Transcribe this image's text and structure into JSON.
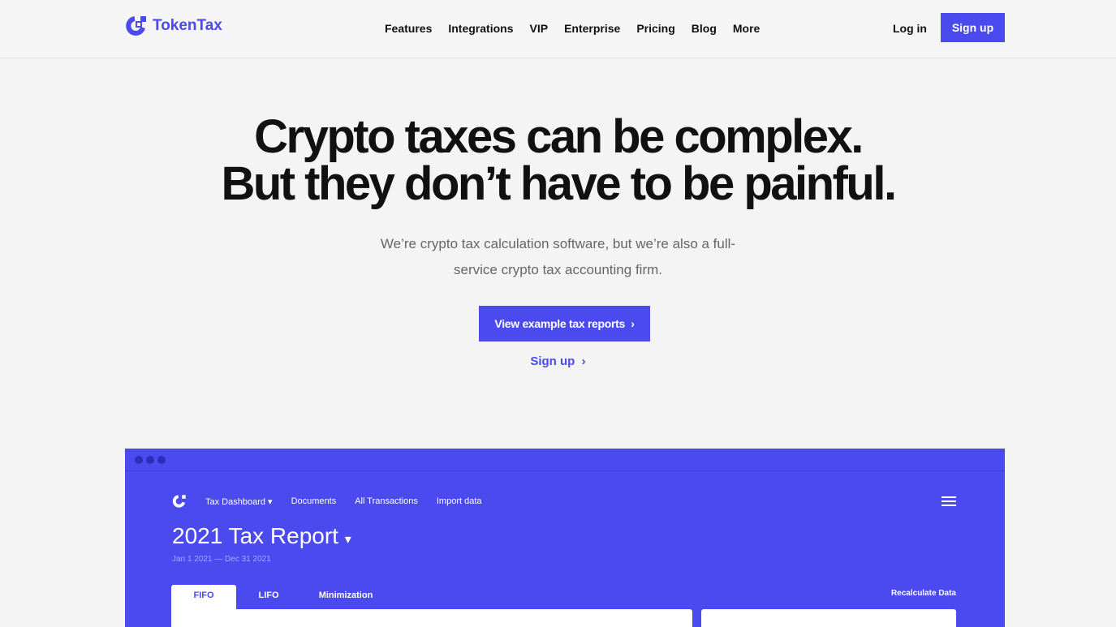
{
  "brand": {
    "name": "TokenTax",
    "color": "#4a4aee"
  },
  "nav": {
    "links": [
      "Features",
      "Integrations",
      "VIP",
      "Enterprise",
      "Pricing",
      "Blog",
      "More"
    ],
    "login": "Log in",
    "signup": "Sign up"
  },
  "hero": {
    "line1": "Crypto taxes can be complex.",
    "line2": "But they don’t have to be painful.",
    "subtitle": "We’re crypto tax calculation software, but we’re also a full-service crypto tax accounting firm.",
    "cta": "View example tax reports",
    "cta_icon": "chevron-right-icon",
    "signup": "Sign up"
  },
  "dashboard": {
    "nav": [
      "Tax Dashboard",
      "Documents",
      "All Transactions",
      "Import data"
    ],
    "title": "2021 Tax Report",
    "dates": "Jan 1 2021 — Dec 31 2021",
    "tabs": [
      "FIFO",
      "LIFO",
      "Minimization"
    ],
    "active_tab": "FIFO",
    "recalculate": "Recalculate Data"
  }
}
